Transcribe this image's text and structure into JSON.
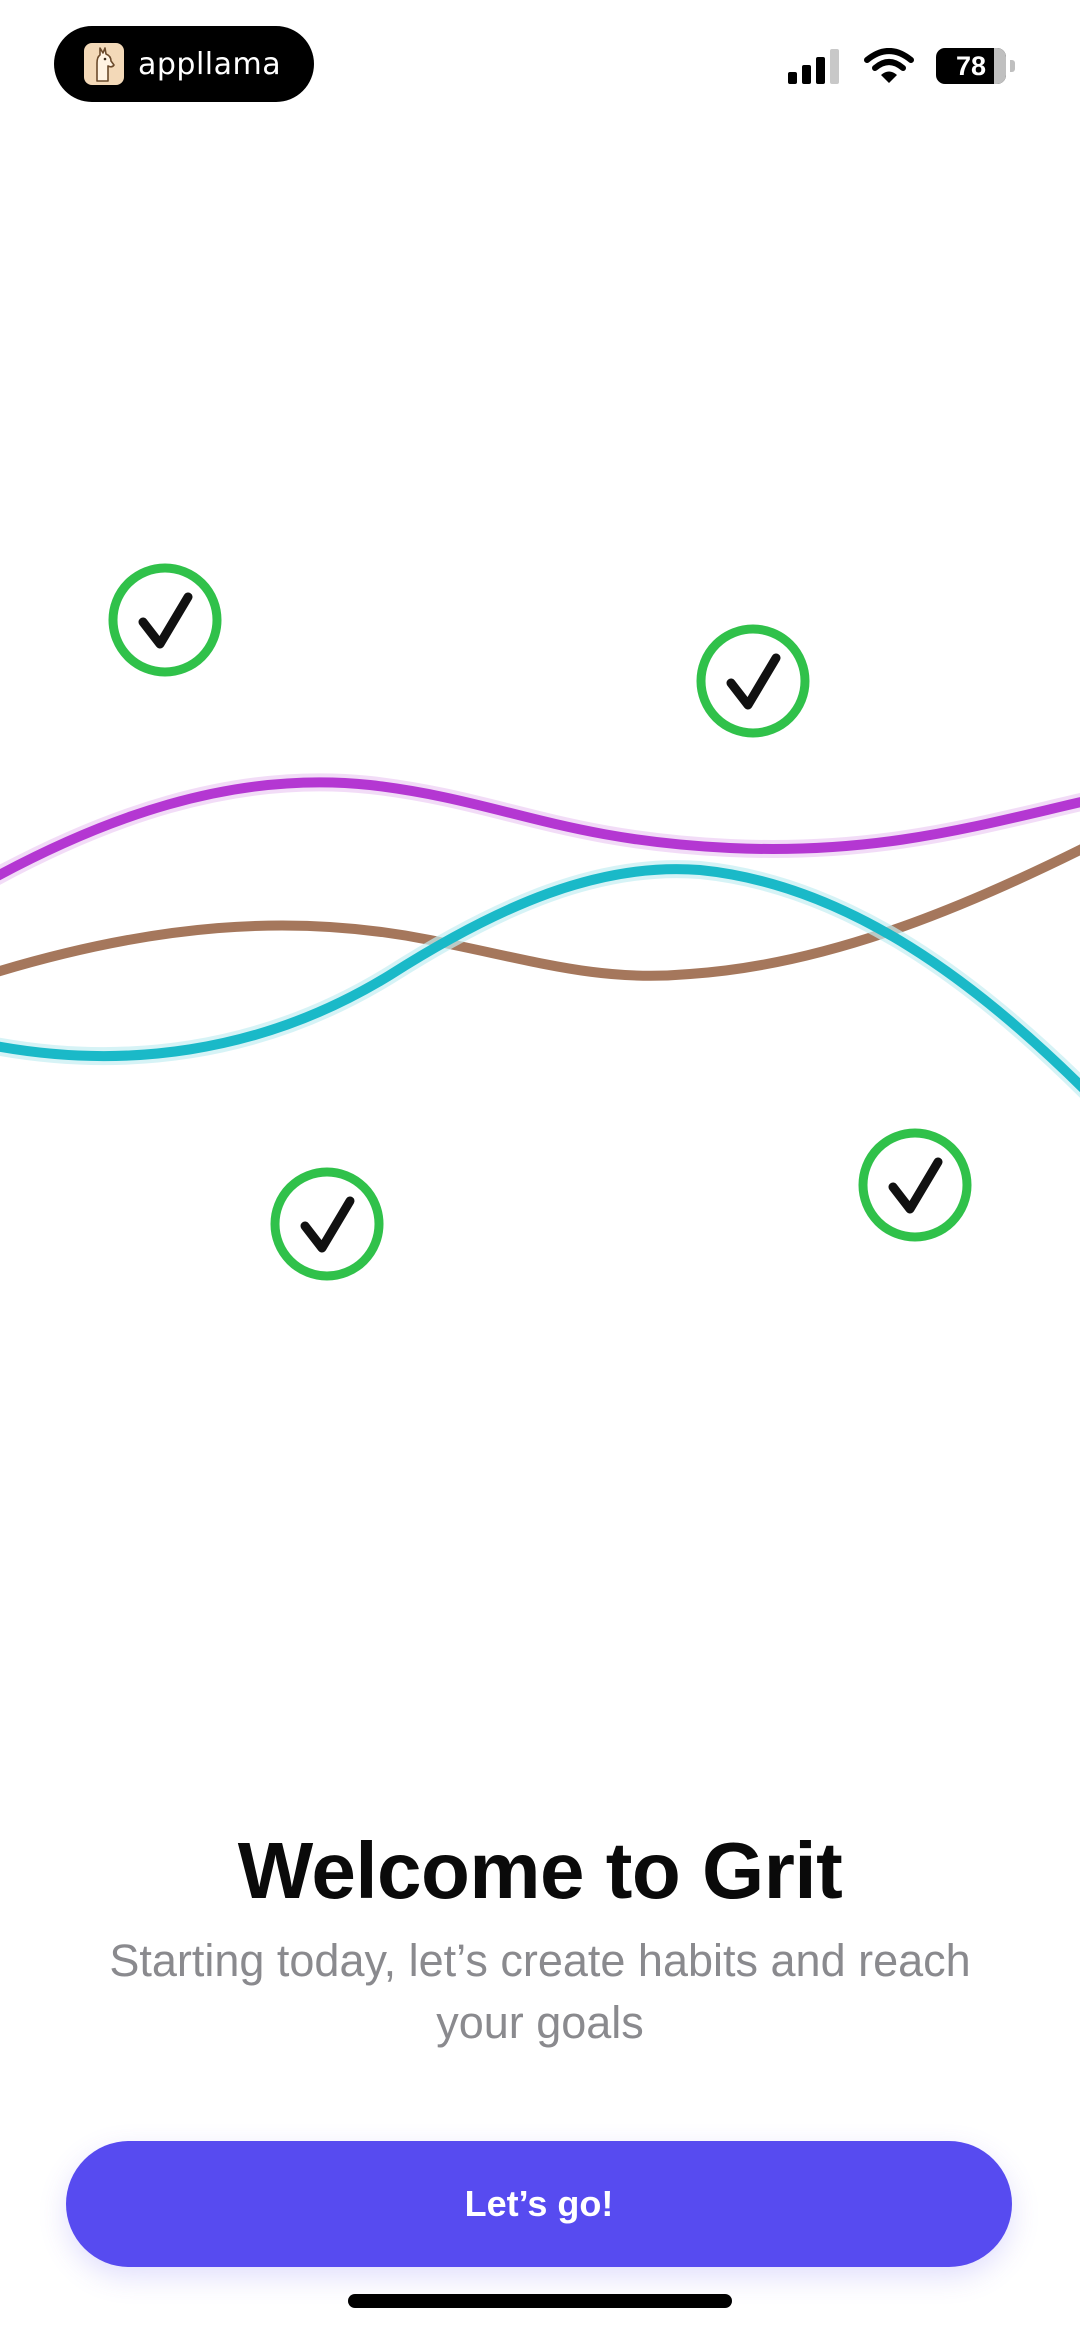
{
  "status_bar": {
    "app_pill_label": "appllama",
    "battery_level": "78",
    "icons": [
      "llama-logo-icon",
      "cellular-signal-icon",
      "wifi-icon",
      "battery-icon"
    ]
  },
  "illustration": {
    "line_colors": [
      "#b437d2",
      "#a5775c",
      "#1ab9c8"
    ],
    "check_ring_color": "#30c14a",
    "check_icons": [
      "check-circle-icon",
      "check-circle-icon",
      "check-circle-icon",
      "check-circle-icon"
    ]
  },
  "welcome": {
    "title": "Welcome to Grit",
    "subtitle": "Starting today, let’s create habits and reach your goals"
  },
  "cta": {
    "label": "Let’s go!",
    "color": "#574bf0"
  }
}
